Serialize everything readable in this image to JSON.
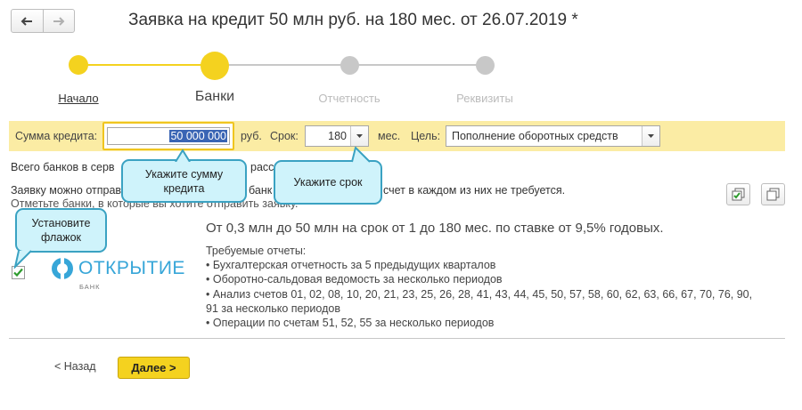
{
  "header": {
    "title": "Заявка на кредит 50 млн руб. на 180 мес. от 26.07.2019 *",
    "back_icon": "arrow-left-icon",
    "forward_icon": "arrow-right-icon"
  },
  "steps": [
    {
      "label": "Начало",
      "state": "done"
    },
    {
      "label": "Банки",
      "state": "current"
    },
    {
      "label": "Отчетность",
      "state": "pending"
    },
    {
      "label": "Реквизиты",
      "state": "pending"
    }
  ],
  "params": {
    "amount_label": "Сумма кредита:",
    "amount_value": "50 000 000",
    "currency": "руб.",
    "term_label": "Срок:",
    "term_value": "180",
    "term_unit": "мес.",
    "purpose_label": "Цель:",
    "purpose_value": "Пополнение оборотных средств"
  },
  "info": {
    "line1": "Всего банков в серв",
    "line1_tail": "расс",
    "line2": "Заявку можно отправ",
    "line2_mid": "банк",
    "line2_tail": "счет в каждом из них не требуется.",
    "line3": "Отметьте банки, в которые вы хотите отправить заявку."
  },
  "callouts": {
    "amount": "Укажите сумму кредита",
    "term": "Укажите срок",
    "checkbox": "Установите флажок"
  },
  "bank": {
    "logo_name": "ОТКРЫТИЕ",
    "logo_sub": "БАНК",
    "checked": true,
    "headline": "От 0,3 млн до 50 млн на срок от 1 до 180 мес. по ставке от 9,5% годовых.",
    "reports_title": "Требуемые отчеты:",
    "reports": [
      "• Бухгалтерская отчетность за 5 предыдущих кварталов",
      "• Оборотно-сальдовая ведомость за несколько периодов",
      "• Анализ счетов 01, 02, 08, 10, 20, 21, 23, 25, 26, 28, 41, 43, 44, 45, 50, 57, 58, 60, 62, 63, 66, 67, 70, 76, 90,",
      "91 за несколько периодов",
      "• Операции по счетам 51, 52, 55 за несколько периодов"
    ]
  },
  "footer": {
    "back_label": "< Назад",
    "next_label": "Далее >"
  },
  "colors": {
    "accent_yellow": "#f4d21f",
    "pending_gray": "#c8c8c8",
    "band": "#fbeca4",
    "callout_bg": "#cff3fb",
    "callout_border": "#3aa2c2",
    "logo_blue": "#37a6d8"
  }
}
